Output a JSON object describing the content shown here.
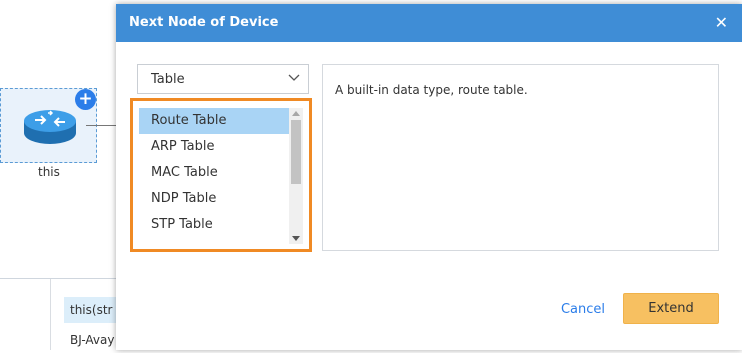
{
  "canvas": {
    "node_label": "this",
    "plus_symbol": "+",
    "table_cells": [
      "this(str",
      "BJ-Avay"
    ]
  },
  "dialog": {
    "title": "Next Node of Device",
    "close_symbol": "✕",
    "type_select": {
      "value": "Table",
      "icon": "chevron-down-icon"
    },
    "list_items": [
      "Route Table",
      "ARP Table",
      "MAC Table",
      "NDP Table",
      "STP Table"
    ],
    "selected_item": "Route Table",
    "description": "A built-in data type, route table.",
    "cancel_label": "Cancel",
    "extend_label": "Extend"
  },
  "colors": {
    "header": "#3f8dd6",
    "highlight_border": "#f08a24",
    "selected_row": "#a9d4f5",
    "extend_button": "#f7c061",
    "link": "#2b7de9"
  }
}
